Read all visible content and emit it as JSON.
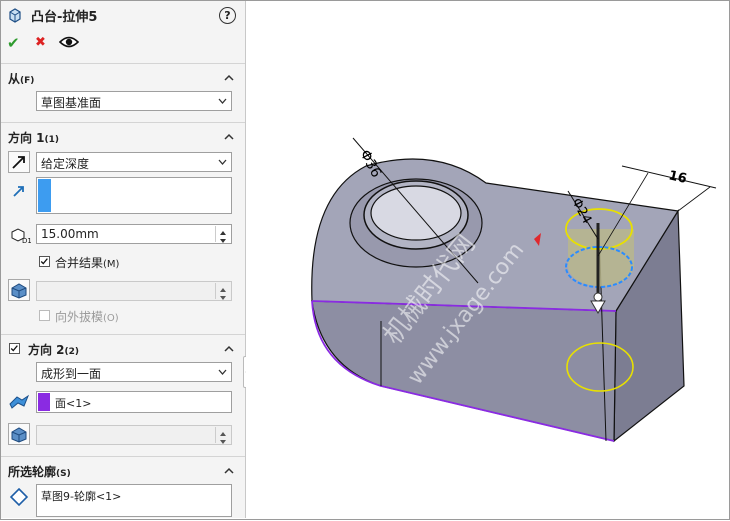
{
  "panel": {
    "title": "凸台-拉伸5",
    "help": "?",
    "actions": {
      "ok": "✔",
      "cancel": "✖"
    },
    "from": {
      "title": "从",
      "key": "(F)",
      "value": "草图基准面"
    },
    "direction1": {
      "title": "方向 1",
      "key": "(1)",
      "end_condition": "给定深度",
      "depth": "15.00mm",
      "merge_label": "合并结果",
      "merge_key": "(M)",
      "merge_checked": true,
      "draft_label": "向外拔模",
      "draft_key": "(O)",
      "draft_checked": false
    },
    "direction2": {
      "title": "方向 2",
      "key": "(2)",
      "checked": true,
      "end_condition": "成形到一面",
      "face": "面<1>"
    },
    "contours": {
      "title": "所选轮廓",
      "key": "(S)",
      "value": "草图9-轮廓<1>"
    }
  },
  "viewport": {
    "dim_diameter_large": "Φ36",
    "dim_diameter_small": "Φ24",
    "dim_length": "16",
    "watermark_line1": "机械时代网",
    "watermark_line2": "www.jxage.com",
    "colors": {
      "body": "#8f90a4",
      "top_face": "#a4a6b8",
      "accent_purple": "#8a2be2",
      "highlight_yellow": "#e8e000",
      "highlight_blue": "#2a8cff"
    }
  }
}
